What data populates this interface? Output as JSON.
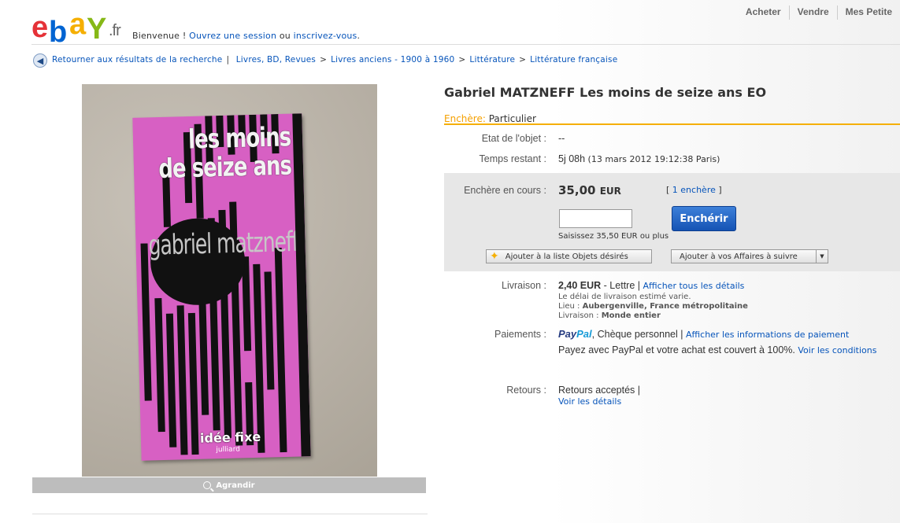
{
  "header": {
    "logo_text": "ebay",
    "logo_tld": ".fr",
    "welcome_prefix": "Bienvenue ! ",
    "signin_link": "Ouvrez une session",
    "or_text": " ou ",
    "register_link": "inscrivez-vous",
    "welcome_suffix": ".",
    "nav": [
      "Acheter",
      "Vendre",
      "Mes Petite"
    ]
  },
  "breadcrumb": {
    "back_label": "Retourner aux résultats de la recherche",
    "items": [
      "Livres, BD, Revues",
      "Livres anciens - 1900 à 1960",
      "Littérature",
      "Littérature française"
    ]
  },
  "image": {
    "book_title": "les moins de seize ans",
    "book_author": "gabriel matzneff",
    "book_publisher": "idée fixe",
    "book_editor": "julliard",
    "enlarge_label": "Agrandir"
  },
  "item": {
    "title": "Gabriel MATZNEFF Les moins de seize ans EO",
    "auction_type_label": "Enchère:",
    "auction_type_value": "Particulier",
    "condition_label": "Etat de l'objet :",
    "condition_value": "--",
    "time_label": "Temps restant :",
    "time_value": "5j 08h",
    "time_detail": "(13 mars 2012 19:12:38 Paris)"
  },
  "bid": {
    "current_label": "Enchère en cours :",
    "amount": "35,00",
    "currency": "EUR",
    "bids_open": "[ ",
    "bids_link": "1 enchère",
    "bids_close": " ]",
    "input_value": "",
    "button_label": "Enchérir",
    "hint": "Saisissez 35,50 EUR ou plus",
    "watch_label": "Ajouter à la liste Objets désirés",
    "follow_label": "Ajouter à vos Affaires à suivre"
  },
  "shipping": {
    "label": "Livraison :",
    "price": "2,40 EUR",
    "method": " - Lettre",
    "details_link": "Afficher tous les détails",
    "delay_note": "Le délai de livraison estimé varie.",
    "location_label": "Lieu : ",
    "location_value": "Aubergenville, France métropolitaine",
    "ships_to_label": "Livraison : ",
    "ships_to_value": "Monde entier"
  },
  "payments": {
    "label": "Paiements :",
    "paypal_p1": "Pay",
    "paypal_p2": "Pal",
    "other": ", Chèque personnel",
    "info_link": "Afficher les informations de paiement",
    "protection_text": "Payez avec PayPal et votre achat est couvert à 100%.",
    "conditions_link": "Voir les conditions"
  },
  "returns": {
    "label": "Retours :",
    "value": "Retours acceptés",
    "details_link": "Voir les détails"
  },
  "colors": {
    "accent_yellow": "#f5af02",
    "link_blue": "#0654ba",
    "book_pink": "#d760c3"
  }
}
